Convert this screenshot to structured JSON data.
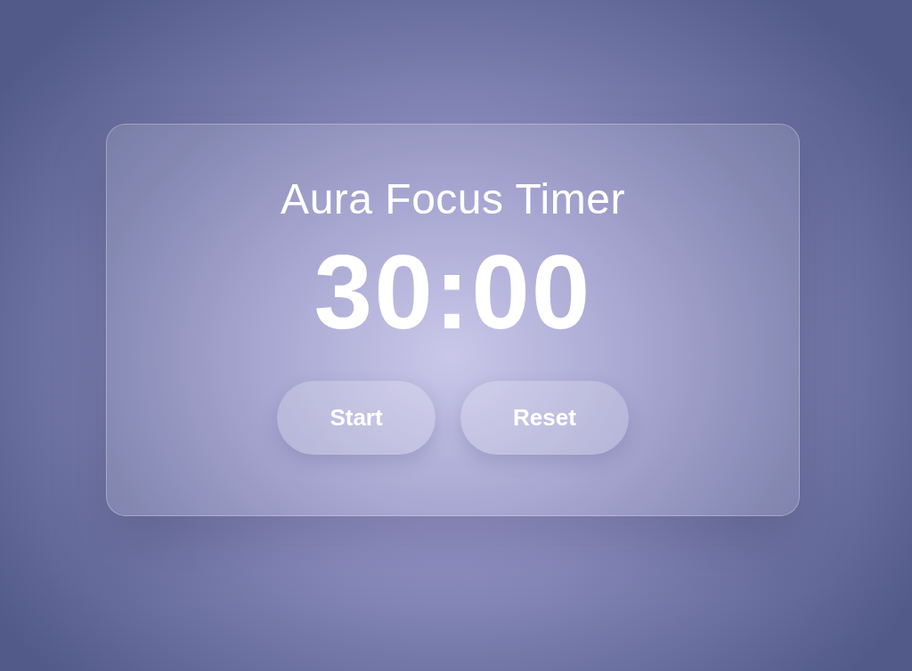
{
  "title": "Aura Focus Timer",
  "time": "30:00",
  "buttons": [
    {
      "label": "Start"
    },
    {
      "label": "Reset"
    }
  ]
}
